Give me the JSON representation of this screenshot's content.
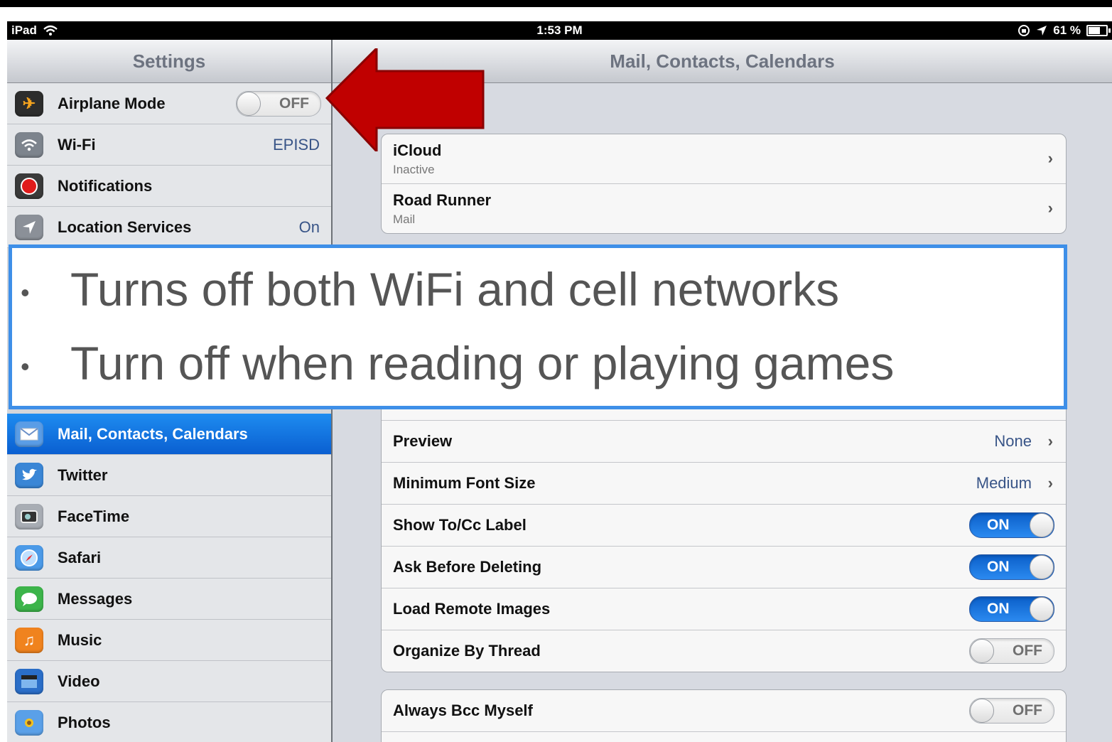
{
  "status": {
    "device": "iPad",
    "time": "1:53 PM",
    "battery": "61 %"
  },
  "sidebar": {
    "title": "Settings",
    "top_items": [
      {
        "label": "Airplane Mode",
        "toggle": "OFF",
        "icon": "airplane-icon",
        "color": "#f08c1e"
      },
      {
        "label": "Wi-Fi",
        "value": "EPISD",
        "icon": "wifi-icon",
        "color": "#7d848d"
      },
      {
        "label": "Notifications",
        "icon": "notifications-icon",
        "color": "#5a5a5a"
      },
      {
        "label": "Location Services",
        "value": "On",
        "icon": "location-icon",
        "color": "#7d848d"
      }
    ],
    "bottom_items": [
      {
        "label": "Mail, Contacts, Calendars",
        "icon": "mail-icon",
        "color": "#4c8fe0",
        "selected": true
      },
      {
        "label": "Twitter",
        "icon": "twitter-icon",
        "color": "#3a86d6"
      },
      {
        "label": "FaceTime",
        "icon": "facetime-icon",
        "color": "#8a8f96"
      },
      {
        "label": "Safari",
        "icon": "safari-icon",
        "color": "#3b8ce0"
      },
      {
        "label": "Messages",
        "icon": "messages-icon",
        "color": "#3cb44a"
      },
      {
        "label": "Music",
        "icon": "music-icon",
        "color": "#f0831e"
      },
      {
        "label": "Video",
        "icon": "video-icon",
        "color": "#2a6ec8"
      },
      {
        "label": "Photos",
        "icon": "photos-icon",
        "color": "#4a8fe0"
      }
    ]
  },
  "main": {
    "title": "Mail, Contacts, Calendars",
    "accounts": [
      {
        "label": "iCloud",
        "sub": "Inactive"
      },
      {
        "label": "Road Runner",
        "sub": "Mail"
      }
    ],
    "settings": [
      {
        "label": "Preview",
        "value": "None"
      },
      {
        "label": "Minimum Font Size",
        "value": "Medium"
      },
      {
        "label": "Show To/Cc Label",
        "toggle": "ON"
      },
      {
        "label": "Ask Before Deleting",
        "toggle": "ON"
      },
      {
        "label": "Load Remote Images",
        "toggle": "ON"
      },
      {
        "label": "Organize By Thread",
        "toggle": "OFF"
      }
    ],
    "group2": [
      {
        "label": "Always Bcc Myself",
        "toggle": "OFF"
      }
    ]
  },
  "callout": {
    "bullets": [
      "Turns off both WiFi and cell networks",
      "Turn off when reading or playing games"
    ]
  },
  "colors": {
    "arrow": "#c00000",
    "callout_border": "#3e8fe8",
    "selected": "#1a78e6"
  }
}
